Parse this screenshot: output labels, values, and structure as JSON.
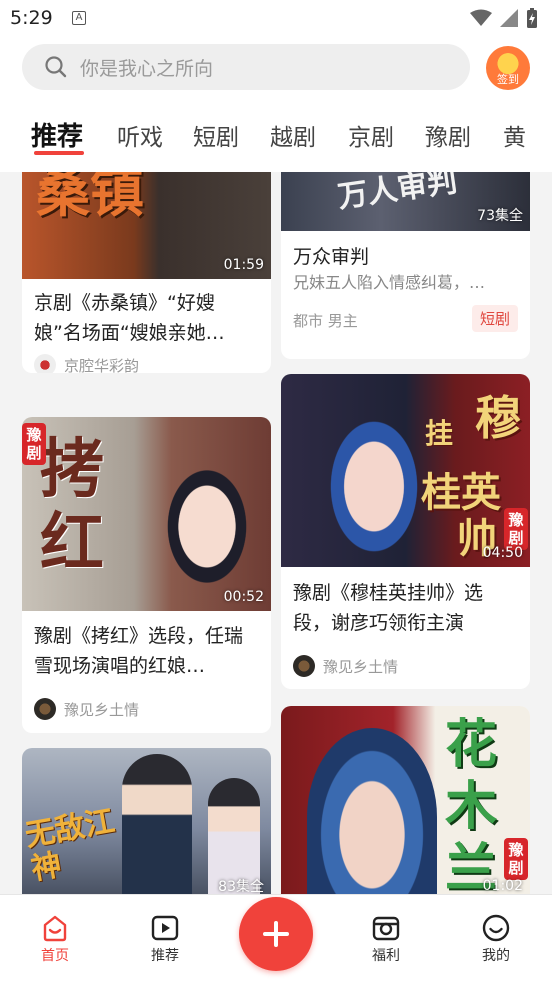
{
  "status": {
    "time": "5:29",
    "a_icon": "A"
  },
  "search": {
    "placeholder": "你是我心之所向",
    "signin_label": "签到"
  },
  "tabs": [
    {
      "label": "推荐"
    },
    {
      "label": "听戏"
    },
    {
      "label": "短剧"
    },
    {
      "label": "越剧"
    },
    {
      "label": "京剧"
    },
    {
      "label": "豫剧"
    },
    {
      "label": "黄"
    }
  ],
  "cards": {
    "c1": {
      "thumb_text": "桑镇",
      "duration": "01:59",
      "title": "京剧《赤桑镇》“好嫂娘”名场面“嫂娘亲她…",
      "author": "京腔华彩韵"
    },
    "c2": {
      "thumb_text": "万人审判",
      "episodes": "73集全",
      "title": "万众审判",
      "subtitle": "兄妹五人陷入情感纠葛，…",
      "genre": "都市  男主",
      "badge": "短剧"
    },
    "c3": {
      "tag": "豫剧",
      "thumb_text": "拷红",
      "duration": "00:52",
      "title": "豫剧《拷红》选段，任瑞雪现场演唱的红娘…",
      "author": "豫见乡土情"
    },
    "c4": {
      "thumb_text_a": "穆",
      "thumb_text_b": "桂英",
      "thumb_text_c": "帅",
      "thumb_text_d": "挂",
      "tag": "豫剧",
      "duration": "04:50",
      "title": "豫剧《穆桂英挂帅》选段，谢彦巧领衔主演",
      "author": "豫见乡土情"
    },
    "c5": {
      "thumb_text": "无敌江神",
      "episodes": "83集全"
    },
    "c6": {
      "thumb_text": "花木兰",
      "tag": "豫剧",
      "duration": "01:02"
    }
  },
  "bottom_nav": [
    {
      "label": "首页",
      "icon": "home-icon"
    },
    {
      "label": "推荐",
      "icon": "play-icon"
    },
    {
      "label": "",
      "icon": "plus-icon"
    },
    {
      "label": "福利",
      "icon": "gift-icon"
    },
    {
      "label": "我的",
      "icon": "smile-icon"
    }
  ],
  "colors": {
    "accent": "#f0423b",
    "tag_red": "#d7262a"
  }
}
